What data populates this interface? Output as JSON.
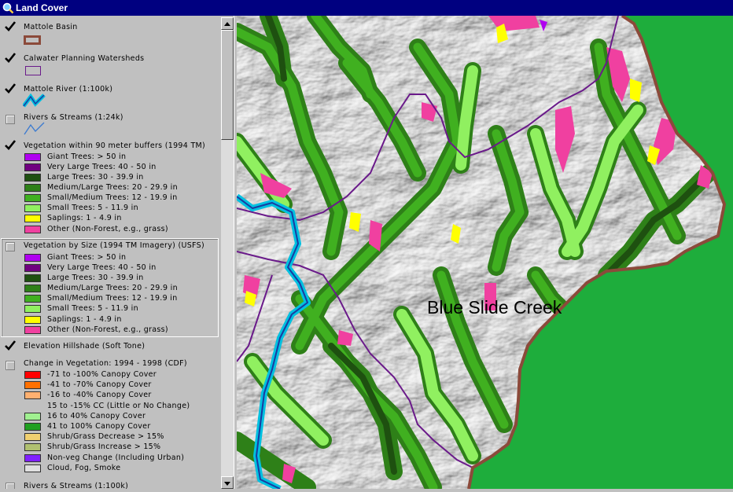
{
  "window": {
    "title": "Land Cover"
  },
  "legend": {
    "layers": [
      {
        "name": "Mattole Basin",
        "checked": true
      },
      {
        "name": "Calwater Planning Watersheds",
        "checked": true
      },
      {
        "name": "Mattole River (1:100k)",
        "checked": true
      },
      {
        "name": "Rivers & Streams (1:24k)",
        "checked": false
      },
      {
        "name": "Vegetation within 90 meter buffers (1994 TM)",
        "checked": true,
        "classes": [
          {
            "label": "Giant Trees: > 50 in",
            "color": "#b000f0"
          },
          {
            "label": "Very Large Trees: 40 - 50 in",
            "color": "#700080"
          },
          {
            "label": "Large Trees: 30 - 39.9 in",
            "color": "#1e5010"
          },
          {
            "label": "Medium/Large Trees: 20 - 29.9 in",
            "color": "#2e8018"
          },
          {
            "label": "Small/Medium Trees: 12 - 19.9 in",
            "color": "#40b020"
          },
          {
            "label": "Small Trees: 5 - 11.9 in",
            "color": "#90f060"
          },
          {
            "label": "Saplings: 1 - 4.9 in",
            "color": "#ffff00"
          },
          {
            "label": "Other (Non-Forest, e.g., grass)",
            "color": "#f040a0"
          }
        ]
      },
      {
        "name": "Vegetation by Size (1994 TM Imagery) (USFS)",
        "checked": false,
        "classes": [
          {
            "label": "Giant Trees: > 50 in",
            "color": "#b000f0"
          },
          {
            "label": "Very Large Trees: 40 - 50 in",
            "color": "#700080"
          },
          {
            "label": "Large Trees: 30 - 39.9 in",
            "color": "#1e5010"
          },
          {
            "label": "Medium/Large Trees: 20 - 29.9 in",
            "color": "#2e8018"
          },
          {
            "label": "Small/Medium Trees: 12 - 19.9 in",
            "color": "#40b020"
          },
          {
            "label": "Small Trees: 5 - 11.9 in",
            "color": "#90f060"
          },
          {
            "label": "Saplings: 1 - 4.9 in",
            "color": "#ffff00"
          },
          {
            "label": "Other (Non-Forest, e.g., grass)",
            "color": "#f040a0"
          }
        ]
      },
      {
        "name": "Elevation Hillshade (Soft Tone)",
        "checked": true
      },
      {
        "name": "Change in Vegetation: 1994 - 1998 (CDF)",
        "checked": false,
        "classes": [
          {
            "label": "-71 to -100% Canopy Cover",
            "color": "#ff0000"
          },
          {
            "label": "-41 to -70% Canopy Cover",
            "color": "#ff7000"
          },
          {
            "label": "-16 to -40% Canopy Cover",
            "color": "#ffb070"
          },
          {
            "label": "15 to -15% CC (Little or No Change)",
            "color": ""
          },
          {
            "label": "16 to 40% Canopy Cover",
            "color": "#a0f090"
          },
          {
            "label": "41 to 100% Canopy Cover",
            "color": "#20a020"
          },
          {
            "label": "Shrub/Grass Decrease > 15%",
            "color": "#f0d070"
          },
          {
            "label": "Shrub/Grass Increase > 15%",
            "color": "#b0c070"
          },
          {
            "label": "Non-veg Change (Including Urban)",
            "color": "#8020ff"
          },
          {
            "label": "Cloud, Fog, Smoke",
            "color": "#e0e0e0"
          }
        ]
      },
      {
        "name": "Rivers & Streams (1:100k)",
        "checked": false
      }
    ]
  },
  "map": {
    "label": "Blue Slide Creek",
    "colors": {
      "ocean_green": "#1ead3c",
      "basin_outline": "#8b4a3a",
      "watershed_line": "#6a1a8a",
      "river": "#00a0c8"
    }
  }
}
